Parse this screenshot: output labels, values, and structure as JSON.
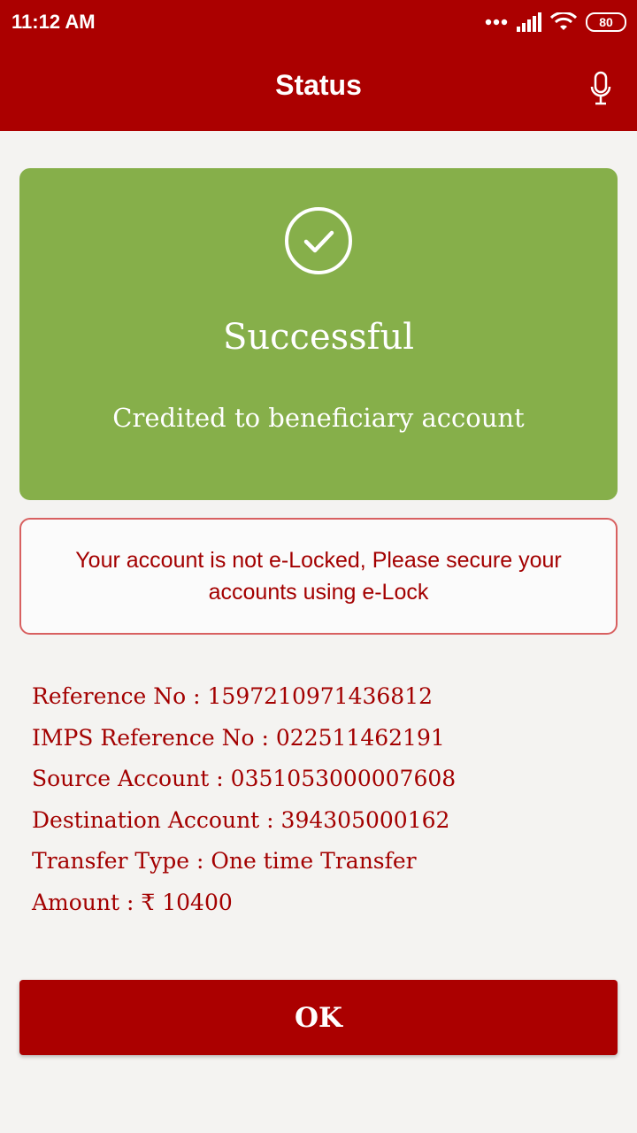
{
  "status_bar": {
    "time": "11:12 AM",
    "battery": "80",
    "icons": [
      "dots-icon",
      "signal-icon",
      "wifi-icon",
      "battery-icon"
    ]
  },
  "app_bar": {
    "title": "Status",
    "mic_icon": "microphone-icon"
  },
  "success_card": {
    "icon": "check-circle-icon",
    "title": "Successful",
    "subtitle": "Credited to beneficiary account",
    "background_color": "#86af4a"
  },
  "warning": {
    "text": "Your account is not e-Locked, Please secure your accounts using e-Lock"
  },
  "details": [
    {
      "label": "Reference No",
      "value": "1597210971436812"
    },
    {
      "label": "IMPS Reference No",
      "value": "022511462191"
    },
    {
      "label": "Source Account",
      "value": "0351053000007608"
    },
    {
      "label": "Destination Account",
      "value": "394305000162"
    },
    {
      "label": "Transfer Type",
      "value": "One time Transfer"
    },
    {
      "label": "Amount",
      "value": "₹ 10400"
    }
  ],
  "ok_button": {
    "label": "OK"
  },
  "colors": {
    "primary": "#ab0000",
    "success": "#86af4a",
    "text_red": "#a30000"
  }
}
